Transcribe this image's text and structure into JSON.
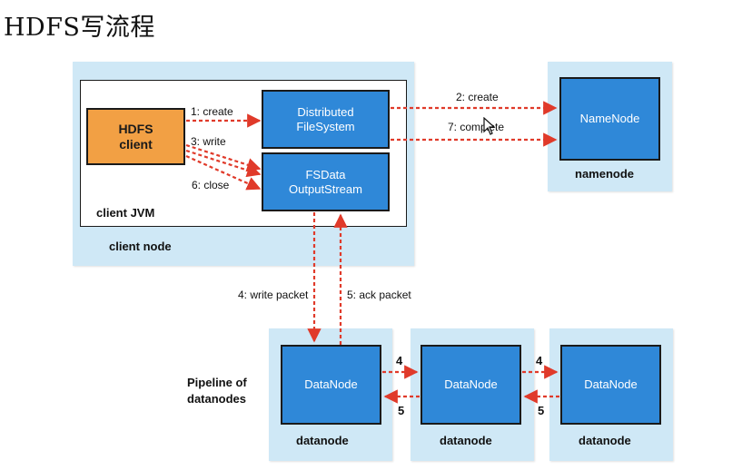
{
  "title": "HDFS写流程",
  "client_node": {
    "label": "client node",
    "jvm_label": "client JVM",
    "hdfs_client": [
      "HDFS",
      "client"
    ],
    "dfs_box": [
      "Distributed",
      "FileSystem"
    ],
    "fsdata_box": [
      "FSData",
      "OutputStream"
    ]
  },
  "namenode": {
    "box": "NameNode",
    "label": "namenode"
  },
  "datanodes": {
    "pipeline_label": [
      "Pipeline of",
      "datanodes"
    ],
    "items": [
      {
        "box": "DataNode",
        "label": "datanode"
      },
      {
        "box": "DataNode",
        "label": "datanode"
      },
      {
        "box": "DataNode",
        "label": "datanode"
      }
    ]
  },
  "steps": {
    "create": "1: create",
    "write": "3: write",
    "close": "6: close",
    "nn_create": "2: create",
    "complete": "7: complete",
    "write_packet": "4: write packet",
    "ack_packet": "5: ack packet",
    "fwd_1": "4",
    "back_1": "5",
    "fwd_2": "4",
    "back_2": "5"
  },
  "colors": {
    "panel": "#cfe8f6",
    "box_blue": "#2f88d8",
    "box_orange": "#f2a044",
    "arrow_red": "#e03a2a"
  }
}
